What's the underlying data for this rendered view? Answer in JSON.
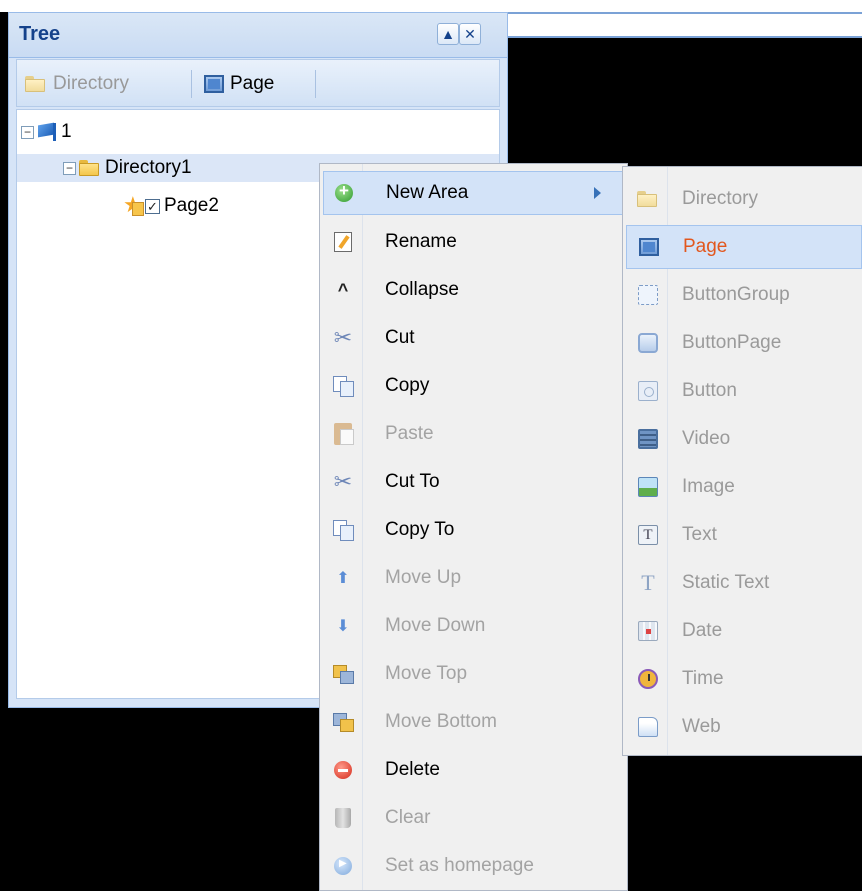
{
  "tree": {
    "title": "Tree",
    "toolbar": {
      "directory_label": "Directory",
      "page_label": "Page"
    },
    "nodes": [
      {
        "label": "1"
      },
      {
        "label": "Directory1"
      },
      {
        "label": "Page2",
        "checked": true
      }
    ]
  },
  "context_menu": {
    "items": [
      {
        "label": "New Area",
        "icon": "add-icon",
        "enabled": true,
        "submenu": true
      },
      {
        "label": "Rename",
        "icon": "rename-icon",
        "enabled": true
      },
      {
        "label": "Collapse",
        "icon": "collapse-icon",
        "enabled": true
      },
      {
        "label": "Cut",
        "icon": "cut-icon",
        "enabled": true
      },
      {
        "label": "Copy",
        "icon": "copy-icon",
        "enabled": true
      },
      {
        "label": "Paste",
        "icon": "paste-icon",
        "enabled": false
      },
      {
        "label": "Cut To",
        "icon": "cut-icon",
        "enabled": true
      },
      {
        "label": "Copy To",
        "icon": "copy-icon",
        "enabled": true
      },
      {
        "label": "Move Up",
        "icon": "arrow-up-icon",
        "enabled": false
      },
      {
        "label": "Move Down",
        "icon": "arrow-down-icon",
        "enabled": false
      },
      {
        "label": "Move Top",
        "icon": "move-top-icon",
        "enabled": false
      },
      {
        "label": "Move Bottom",
        "icon": "move-bottom-icon",
        "enabled": false
      },
      {
        "label": "Delete",
        "icon": "delete-icon",
        "enabled": true
      },
      {
        "label": "Clear",
        "icon": "trash-icon",
        "enabled": false
      },
      {
        "label": "Set as homepage",
        "icon": "homepage-icon",
        "enabled": false
      }
    ]
  },
  "submenu": {
    "items": [
      {
        "label": "Directory",
        "icon": "folder-icon"
      },
      {
        "label": "Page",
        "icon": "page-icon",
        "highlighted": true
      },
      {
        "label": "ButtonGroup",
        "icon": "button-group-icon"
      },
      {
        "label": "ButtonPage",
        "icon": "button-page-icon"
      },
      {
        "label": "Button",
        "icon": "button-icon"
      },
      {
        "label": "Video",
        "icon": "video-icon"
      },
      {
        "label": "Image",
        "icon": "image-icon"
      },
      {
        "label": "Text",
        "icon": "text-icon"
      },
      {
        "label": "Static Text",
        "icon": "static-text-icon"
      },
      {
        "label": "Date",
        "icon": "date-icon"
      },
      {
        "label": "Time",
        "icon": "time-icon"
      },
      {
        "label": "Web",
        "icon": "web-icon"
      }
    ]
  },
  "colors": {
    "accent": "#15428b",
    "highlight_text": "#e2571e",
    "disabled_text": "#a3a3a3"
  }
}
